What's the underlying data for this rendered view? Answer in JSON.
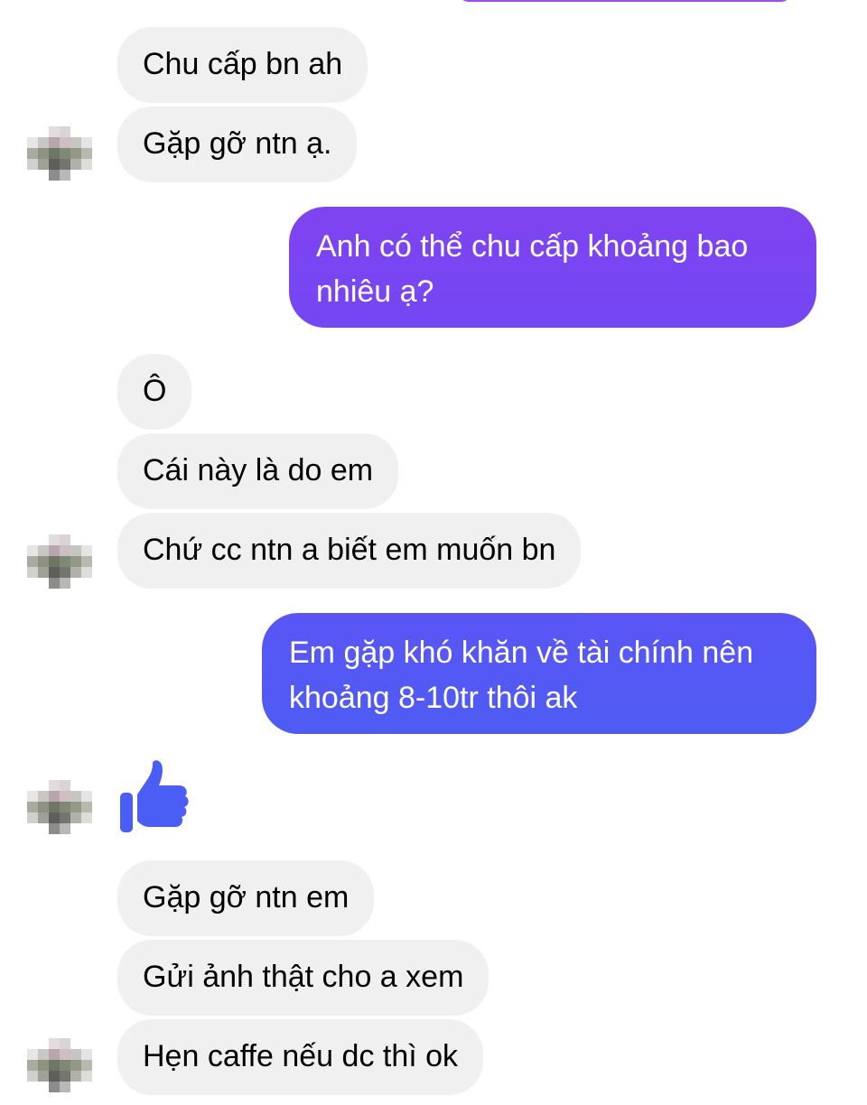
{
  "conversation": {
    "messages": [
      {
        "direction": "incoming",
        "text": "Chu cấp bn ah"
      },
      {
        "direction": "incoming",
        "text": "Gặp gỡ ntn ạ."
      },
      {
        "direction": "outgoing",
        "text": "Anh có thể chu cấp khoảng bao nhiêu ạ?"
      },
      {
        "direction": "incoming",
        "text": "Ô"
      },
      {
        "direction": "incoming",
        "text": "Cái này là do em"
      },
      {
        "direction": "incoming",
        "text": "Chứ cc ntn a biết em muốn bn"
      },
      {
        "direction": "outgoing",
        "text": "Em gặp khó khăn về tài chính nên khoảng 8-10tr thôi ak"
      },
      {
        "direction": "incoming",
        "type": "sticker",
        "icon": "thumbs-up-icon"
      },
      {
        "direction": "incoming",
        "text": "Gặp gỡ ntn em"
      },
      {
        "direction": "incoming",
        "text": "Gửi ảnh thật cho a xem"
      },
      {
        "direction": "incoming",
        "text": "Hẹn caffe nếu dc thì ok"
      }
    ]
  },
  "colors": {
    "incoming_bubble": "#f0f0f0",
    "outgoing_bubble_1": "#7745f2",
    "outgoing_bubble_2": "#5459f4",
    "like_icon": "#4a5df5"
  }
}
